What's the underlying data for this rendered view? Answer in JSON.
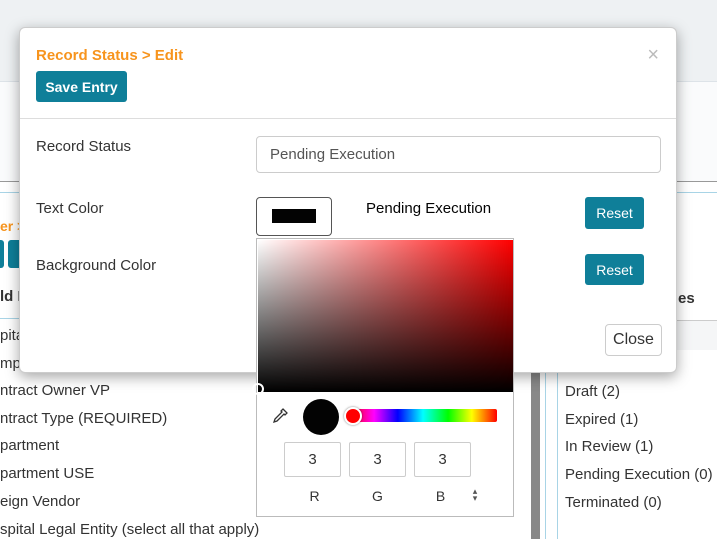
{
  "background": {
    "breadcrumb_fragment": "er >",
    "left_header": "ld L",
    "left_items": [
      "pita",
      "mpl",
      "ntract Owner VP",
      "ntract Type (REQUIRED)",
      "partment",
      "partment USE",
      "eign Vendor",
      "spital Legal Entity (select all that apply)"
    ],
    "right_header": "es",
    "right_items": [
      "Draft (2)",
      "Expired (1)",
      "In Review (1)",
      "Pending Execution (0)",
      "Terminated (0)"
    ]
  },
  "modal": {
    "title": "Record Status > Edit",
    "close_glyph": "×",
    "save_label": "Save Entry",
    "record_status_label": "Record Status",
    "record_status_value": "Pending Execution",
    "text_color_label": "Text Color",
    "text_color_value": "#030303",
    "preview_text": "Pending Execution",
    "background_color_label": "Background Color",
    "reset_label": "Reset",
    "close_label": "Close"
  },
  "picker": {
    "r": "3",
    "g": "3",
    "b": "3",
    "r_label": "R",
    "g_label": "G",
    "b_label": "B",
    "toggle_glyph": "⌃⌄"
  }
}
